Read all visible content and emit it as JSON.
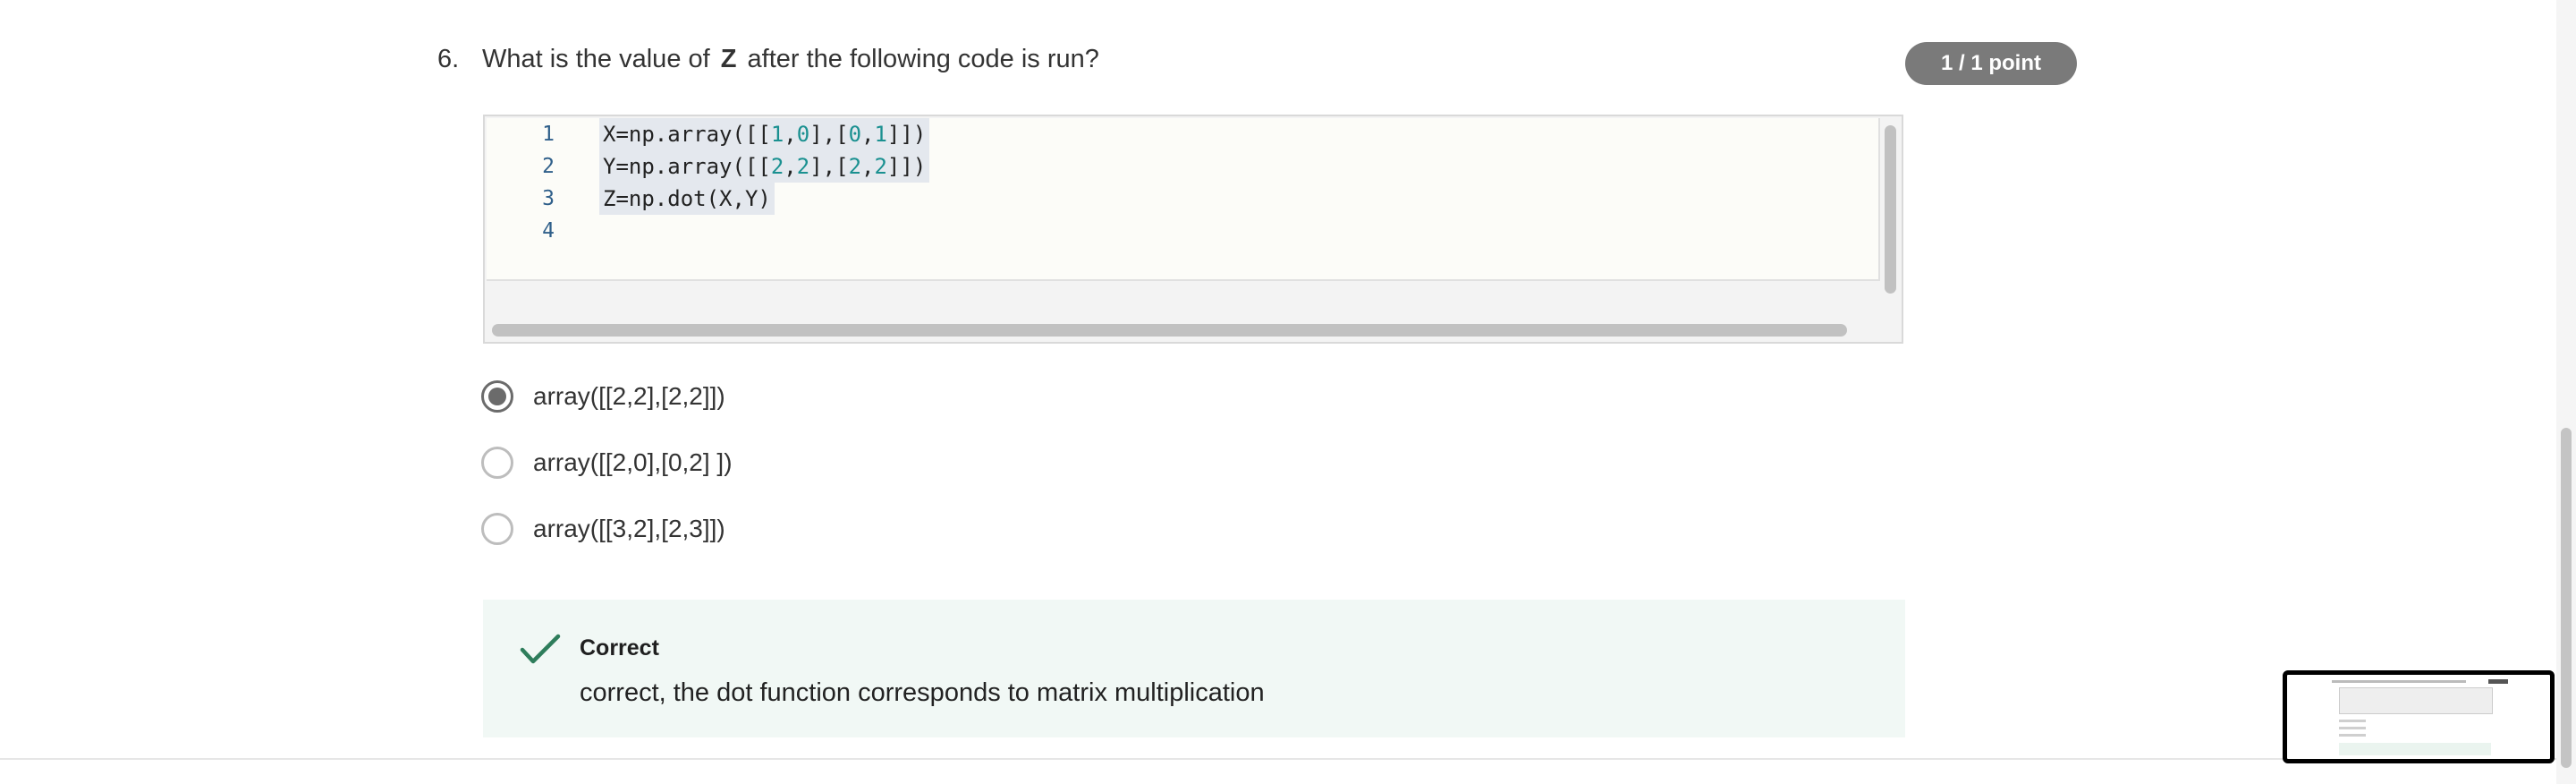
{
  "question": {
    "number": "6.",
    "text_before": "What is the value of",
    "variable": "Z",
    "text_after": "after the following code is run?",
    "points_badge": "1 / 1 point"
  },
  "editor": {
    "lines": [
      {
        "number": "1",
        "code": "X=np.array([[1,0],[0,1]])"
      },
      {
        "number": "2",
        "code": "Y=np.array([[2,2],[2,2]])"
      },
      {
        "number": "3",
        "code": "Z=np.dot(X,Y)"
      },
      {
        "number": "4",
        "code": ""
      }
    ]
  },
  "options": [
    {
      "label": "array([[2,2],[2,2]])",
      "selected": true
    },
    {
      "label": "array([[2,0],[0,2] ])",
      "selected": false
    },
    {
      "label": "array([[3,2],[2,3]])",
      "selected": false
    }
  ],
  "feedback": {
    "status": "Correct",
    "message": "correct, the dot function corresponds to matrix multiplication",
    "icon": "checkmark-icon",
    "color": "#2e7d5b"
  },
  "colors": {
    "badge_bg": "#7a7a7a",
    "feedback_bg": "#f1f8f5",
    "line_number": "#2f5f8a",
    "code_number": "#1a9090"
  }
}
